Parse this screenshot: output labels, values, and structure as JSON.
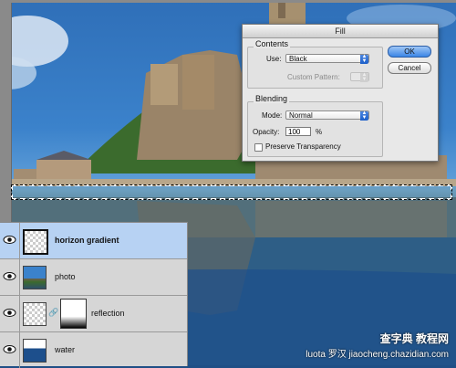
{
  "dialog": {
    "title": "Fill",
    "contents_label": "Contents",
    "use_label": "Use:",
    "use_value": "Black",
    "custom_pattern_label": "Custom Pattern:",
    "blending_label": "Blending",
    "mode_label": "Mode:",
    "mode_value": "Normal",
    "opacity_label": "Opacity:",
    "opacity_value": "100",
    "opacity_unit": "%",
    "preserve_label": "Preserve Transparency",
    "ok_label": "OK",
    "cancel_label": "Cancel"
  },
  "layers": [
    {
      "name": "horizon gradient",
      "active": true
    },
    {
      "name": "photo",
      "active": false
    },
    {
      "name": "reflection",
      "active": false
    },
    {
      "name": "water",
      "active": false
    }
  ],
  "watermark": {
    "line1": "查字典 教程网",
    "line2": "luota 罗汉 jiaocheng.chazidian.com"
  }
}
